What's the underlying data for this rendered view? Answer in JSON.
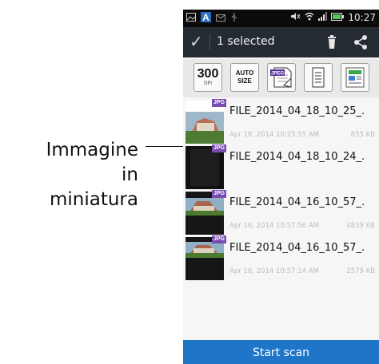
{
  "callout": {
    "line1": "Immagine",
    "line2": "in",
    "line3": "miniatura"
  },
  "status_bar": {
    "time": "10:27",
    "icons": [
      "gallery-icon",
      "a-icon",
      "mail-icon",
      "usb-icon",
      "mute-icon",
      "wifi-icon",
      "signal-icon",
      "battery-icon"
    ]
  },
  "action_bar": {
    "title": "1 selected",
    "icons": [
      "check-icon",
      "trash-icon",
      "share-icon"
    ]
  },
  "toolbar": {
    "dpi_value": "300",
    "dpi_unit": "DPI",
    "auto_line1": "AUTO",
    "auto_line2": "SIZE",
    "jpeg_label": "JPEG",
    "icons": [
      "document-icon",
      "color-photo-icon"
    ]
  },
  "files": [
    {
      "badge": "JPG",
      "name": "FILE_2014_04_18_10_25_.",
      "date": "Apr 18, 2014 10:25:55 AM",
      "size": "855 KB"
    },
    {
      "badge": "JPG",
      "name": "FILE_2014_04_18_10_24_.",
      "date": "",
      "size": ""
    },
    {
      "badge": "JPG",
      "name": "FILE_2014_04_16_10_57_.",
      "date": "Apr 16, 2014 10:57:56 AM",
      "size": "4839 KB"
    },
    {
      "badge": "JPG",
      "name": "FILE_2014_04_16_10_57_.",
      "date": "Apr 16, 2014 10:57:14 AM",
      "size": "2579 KB"
    }
  ],
  "bottom_button": "Start scan",
  "colors": {
    "action_bar": "#252b33",
    "start_scan": "#1f76c8",
    "jpg_badge": "#7a4bb0"
  }
}
